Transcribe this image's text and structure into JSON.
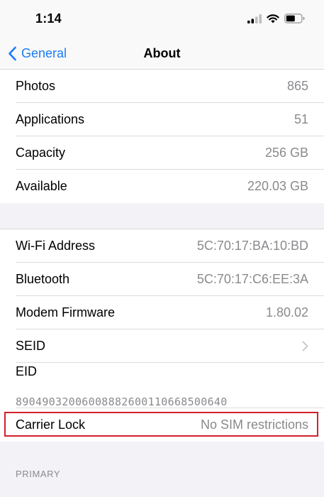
{
  "status_bar": {
    "time": "1:14",
    "icons": [
      "cellular-signal-icon",
      "wifi-icon",
      "battery-icon"
    ]
  },
  "nav": {
    "back_label": "General",
    "back_icon": "chevron-left-icon",
    "title": "About"
  },
  "storage_group": [
    {
      "label": "Photos",
      "value": "865"
    },
    {
      "label": "Applications",
      "value": "51"
    },
    {
      "label": "Capacity",
      "value": "256 GB"
    },
    {
      "label": "Available",
      "value": "220.03 GB"
    }
  ],
  "network_group": {
    "wifi": {
      "label": "Wi-Fi Address",
      "value": "5C:70:17:BA:10:BD"
    },
    "bluetooth": {
      "label": "Bluetooth",
      "value": "5C:70:17:C6:EE:3A"
    },
    "modem": {
      "label": "Modem Firmware",
      "value": "1.80.02"
    },
    "seid": {
      "label": "SEID",
      "icon": "chevron-right-icon"
    },
    "eid": {
      "label": "EID",
      "value": "89049032006008882600110668500640"
    },
    "carrier_lock": {
      "label": "Carrier Lock",
      "value": "No SIM restrictions"
    }
  },
  "section_header": "PRIMARY",
  "colors": {
    "accent": "#1b7cf5",
    "highlight": "#d3212d",
    "secondary_text": "#8a8a8e",
    "background": "#f2f2f7"
  }
}
